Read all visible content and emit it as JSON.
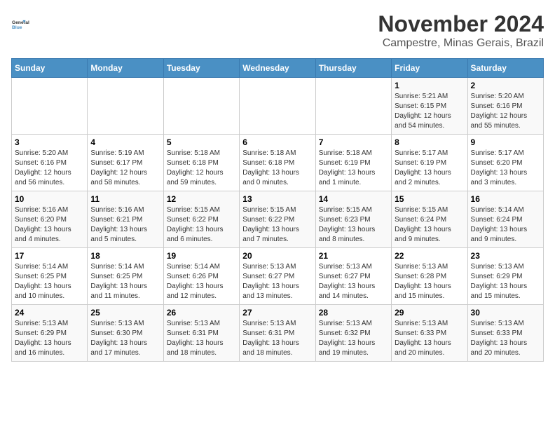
{
  "logo": {
    "general": "General",
    "blue": "Blue"
  },
  "title": "November 2024",
  "subtitle": "Campestre, Minas Gerais, Brazil",
  "days_of_week": [
    "Sunday",
    "Monday",
    "Tuesday",
    "Wednesday",
    "Thursday",
    "Friday",
    "Saturday"
  ],
  "weeks": [
    [
      {
        "day": "",
        "info": ""
      },
      {
        "day": "",
        "info": ""
      },
      {
        "day": "",
        "info": ""
      },
      {
        "day": "",
        "info": ""
      },
      {
        "day": "",
        "info": ""
      },
      {
        "day": "1",
        "info": "Sunrise: 5:21 AM\nSunset: 6:15 PM\nDaylight: 12 hours and 54 minutes."
      },
      {
        "day": "2",
        "info": "Sunrise: 5:20 AM\nSunset: 6:16 PM\nDaylight: 12 hours and 55 minutes."
      }
    ],
    [
      {
        "day": "3",
        "info": "Sunrise: 5:20 AM\nSunset: 6:16 PM\nDaylight: 12 hours and 56 minutes."
      },
      {
        "day": "4",
        "info": "Sunrise: 5:19 AM\nSunset: 6:17 PM\nDaylight: 12 hours and 58 minutes."
      },
      {
        "day": "5",
        "info": "Sunrise: 5:18 AM\nSunset: 6:18 PM\nDaylight: 12 hours and 59 minutes."
      },
      {
        "day": "6",
        "info": "Sunrise: 5:18 AM\nSunset: 6:18 PM\nDaylight: 13 hours and 0 minutes."
      },
      {
        "day": "7",
        "info": "Sunrise: 5:18 AM\nSunset: 6:19 PM\nDaylight: 13 hours and 1 minute."
      },
      {
        "day": "8",
        "info": "Sunrise: 5:17 AM\nSunset: 6:19 PM\nDaylight: 13 hours and 2 minutes."
      },
      {
        "day": "9",
        "info": "Sunrise: 5:17 AM\nSunset: 6:20 PM\nDaylight: 13 hours and 3 minutes."
      }
    ],
    [
      {
        "day": "10",
        "info": "Sunrise: 5:16 AM\nSunset: 6:20 PM\nDaylight: 13 hours and 4 minutes."
      },
      {
        "day": "11",
        "info": "Sunrise: 5:16 AM\nSunset: 6:21 PM\nDaylight: 13 hours and 5 minutes."
      },
      {
        "day": "12",
        "info": "Sunrise: 5:15 AM\nSunset: 6:22 PM\nDaylight: 13 hours and 6 minutes."
      },
      {
        "day": "13",
        "info": "Sunrise: 5:15 AM\nSunset: 6:22 PM\nDaylight: 13 hours and 7 minutes."
      },
      {
        "day": "14",
        "info": "Sunrise: 5:15 AM\nSunset: 6:23 PM\nDaylight: 13 hours and 8 minutes."
      },
      {
        "day": "15",
        "info": "Sunrise: 5:15 AM\nSunset: 6:24 PM\nDaylight: 13 hours and 9 minutes."
      },
      {
        "day": "16",
        "info": "Sunrise: 5:14 AM\nSunset: 6:24 PM\nDaylight: 13 hours and 9 minutes."
      }
    ],
    [
      {
        "day": "17",
        "info": "Sunrise: 5:14 AM\nSunset: 6:25 PM\nDaylight: 13 hours and 10 minutes."
      },
      {
        "day": "18",
        "info": "Sunrise: 5:14 AM\nSunset: 6:25 PM\nDaylight: 13 hours and 11 minutes."
      },
      {
        "day": "19",
        "info": "Sunrise: 5:14 AM\nSunset: 6:26 PM\nDaylight: 13 hours and 12 minutes."
      },
      {
        "day": "20",
        "info": "Sunrise: 5:13 AM\nSunset: 6:27 PM\nDaylight: 13 hours and 13 minutes."
      },
      {
        "day": "21",
        "info": "Sunrise: 5:13 AM\nSunset: 6:27 PM\nDaylight: 13 hours and 14 minutes."
      },
      {
        "day": "22",
        "info": "Sunrise: 5:13 AM\nSunset: 6:28 PM\nDaylight: 13 hours and 15 minutes."
      },
      {
        "day": "23",
        "info": "Sunrise: 5:13 AM\nSunset: 6:29 PM\nDaylight: 13 hours and 15 minutes."
      }
    ],
    [
      {
        "day": "24",
        "info": "Sunrise: 5:13 AM\nSunset: 6:29 PM\nDaylight: 13 hours and 16 minutes."
      },
      {
        "day": "25",
        "info": "Sunrise: 5:13 AM\nSunset: 6:30 PM\nDaylight: 13 hours and 17 minutes."
      },
      {
        "day": "26",
        "info": "Sunrise: 5:13 AM\nSunset: 6:31 PM\nDaylight: 13 hours and 18 minutes."
      },
      {
        "day": "27",
        "info": "Sunrise: 5:13 AM\nSunset: 6:31 PM\nDaylight: 13 hours and 18 minutes."
      },
      {
        "day": "28",
        "info": "Sunrise: 5:13 AM\nSunset: 6:32 PM\nDaylight: 13 hours and 19 minutes."
      },
      {
        "day": "29",
        "info": "Sunrise: 5:13 AM\nSunset: 6:33 PM\nDaylight: 13 hours and 20 minutes."
      },
      {
        "day": "30",
        "info": "Sunrise: 5:13 AM\nSunset: 6:33 PM\nDaylight: 13 hours and 20 minutes."
      }
    ]
  ]
}
